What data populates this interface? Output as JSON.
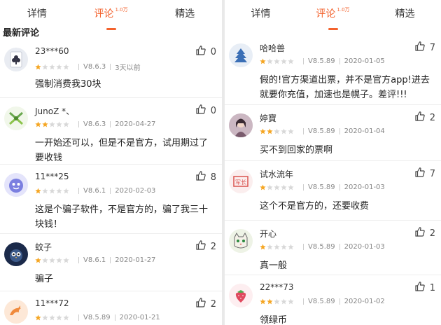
{
  "left": {
    "tabs": [
      {
        "label": "详情",
        "sup": ""
      },
      {
        "label": "评论",
        "sup": "1.0万"
      },
      {
        "label": "精选",
        "sup": ""
      }
    ],
    "section_title": "最新评论",
    "reviews": [
      {
        "avatar": "club-card-avatar",
        "user": "23***60",
        "rating": 1,
        "version": "V8.6.3",
        "date": "3天以前",
        "text": "强制消费我30块",
        "likes": "0"
      },
      {
        "avatar": "green-leaves-avatar",
        "user": "JunoZ *、",
        "rating": 2,
        "version": "V8.6.3",
        "date": "2020-04-27",
        "text": "一开始还可以，但是不是官方，试用期过了要收钱",
        "likes": "0"
      },
      {
        "avatar": "purple-face-avatar",
        "user": "11***25",
        "rating": 1,
        "version": "V8.6.1",
        "date": "2020-02-03",
        "text": "这是个骗子软件，不是官方的，骗了我三十块钱！",
        "likes": "8"
      },
      {
        "avatar": "owl-avatar",
        "user": "蚊子",
        "rating": 1,
        "version": "V8.6.1",
        "date": "2020-01-27",
        "text": "骗子",
        "likes": "2"
      },
      {
        "avatar": "dolphin-avatar",
        "user": "11***72",
        "rating": 1,
        "version": "V8.5.89",
        "date": "2020-01-21",
        "text": "",
        "likes": "2"
      }
    ]
  },
  "right": {
    "tabs": [
      {
        "label": "详情",
        "sup": ""
      },
      {
        "label": "评论",
        "sup": "1.0万"
      },
      {
        "label": "精选",
        "sup": ""
      }
    ],
    "reviews": [
      {
        "avatar": "tree-avatar",
        "user": "哈哈兽",
        "rating": 1,
        "version": "V8.5.89",
        "date": "2020-01-05",
        "text": "假的!官方渠道出票，并不是官方app!进去就要你充值，加速也是幌子。差评!!!",
        "likes": "7"
      },
      {
        "avatar": "girl-photo-avatar",
        "user": "婷寶",
        "rating": 2,
        "version": "V8.5.89",
        "date": "2020-01-04",
        "text": "买不到回家的票啊",
        "likes": "2"
      },
      {
        "avatar": "stamp-avatar",
        "user": "试水流年",
        "rating": 1,
        "version": "V8.5.89",
        "date": "2020-01-03",
        "text": "这个不是官方的，还要收费",
        "likes": "7"
      },
      {
        "avatar": "cat-avatar",
        "user": "开心",
        "rating": 1,
        "version": "V8.5.89",
        "date": "2020-01-03",
        "text": "真一般",
        "likes": "2"
      },
      {
        "avatar": "strawberry-avatar",
        "user": "22***73",
        "rating": 2,
        "version": "V8.5.89",
        "date": "2020-01-02",
        "text": "领绿币",
        "likes": "1"
      }
    ]
  },
  "avatar_stamp_text": "军长",
  "colors": {
    "accent": "#f3622d",
    "star_on": "#f5a623",
    "star_off": "#d8d8d8"
  }
}
